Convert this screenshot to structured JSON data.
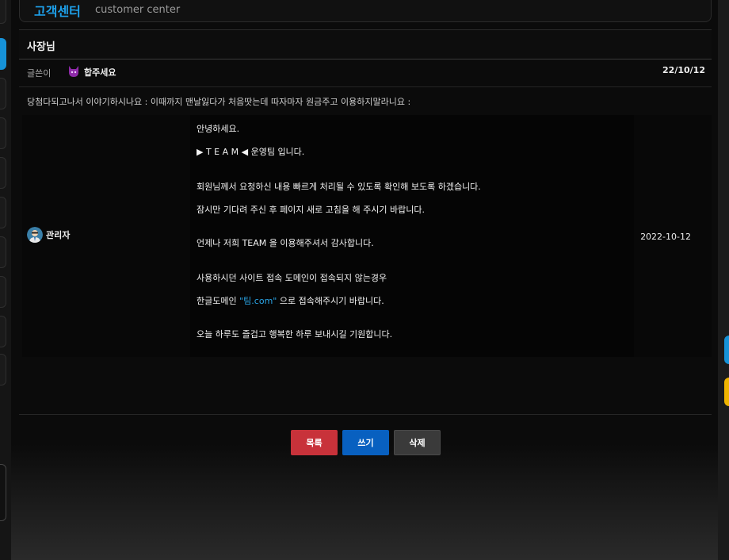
{
  "header": {
    "title": "고객센터",
    "subtitle": "customer center"
  },
  "post": {
    "title": "사장님",
    "writer_label": "글쓴이",
    "writer_name": "합주세요",
    "date": "22/10/12",
    "body": "당첨다되고나서 이야기하시나요 : 이때까지 맨날잃다가 처음땃는데 따자마자 원금주고 이용하지말라니요 :"
  },
  "reply": {
    "author": "관리자",
    "date": "2022-10-12",
    "lines": [
      "안녕하세요.",
      "▶ T E A M ◀ 운영팀 입니다.",
      "회원님께서 요청하신 내용 빠르게 처리될 수 있도록 확인해 보도록 하겠습니다.",
      "잠시만 기다려 주신 후 페이지 새로 고침을 해 주시기 바랍니다.",
      "언제나 저희 TEAM 을 이용해주셔서 감사합니다.",
      "사용하시던 사이트 접속 도메인이 접속되지 않는경우",
      "한글도메인",
      "\"팀.com\"",
      "으로 접속해주시기 바랍니다.",
      "오늘 하루도 즐겁고 행복한 하루 보내시길 기원합니다."
    ]
  },
  "buttons": {
    "list": "목록",
    "write": "쓰기",
    "delete": "삭제"
  },
  "colors": {
    "accent": "#1ea0ea",
    "list_button": "#c8323a",
    "write_button": "#0860c0",
    "delete_button": "#3a3a3a"
  },
  "icons": {
    "writer": "devil-icon",
    "admin": "admin-avatar-icon"
  }
}
